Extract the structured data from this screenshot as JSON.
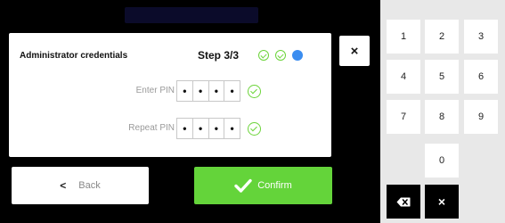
{
  "dialog": {
    "title": "Administrator credentials",
    "step_label": "Step 3/3",
    "steps": [
      "done",
      "done",
      "current"
    ]
  },
  "pin": {
    "enter_label": "Enter PIN",
    "repeat_label": "Repeat PIN",
    "enter_digits": [
      "•",
      "•",
      "•",
      "•"
    ],
    "repeat_digits": [
      "•",
      "•",
      "•",
      "•"
    ]
  },
  "buttons": {
    "close": "×",
    "back_icon": "<",
    "back": "Back",
    "confirm": "Confirm"
  },
  "keypad": {
    "keys": [
      "1",
      "2",
      "3",
      "4",
      "5",
      "6",
      "7",
      "8",
      "9",
      "0"
    ],
    "backspace_icon": "backspace-icon",
    "clear": "×"
  },
  "colors": {
    "accent_green": "#64d43a",
    "step_current_blue": "#3b8df0"
  }
}
